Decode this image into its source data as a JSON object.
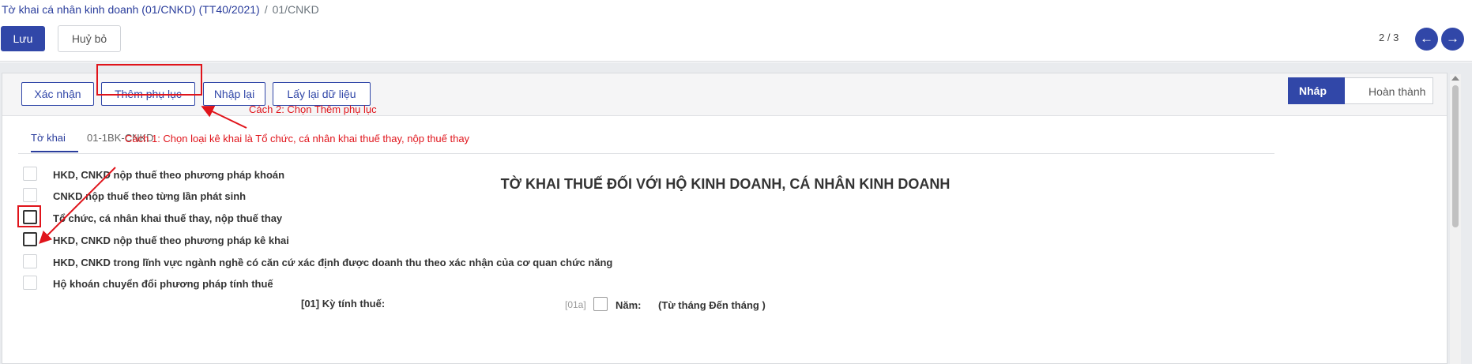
{
  "breadcrumb": {
    "parent": "Tờ khai cá nhân kinh doanh (01/CNKD) (TT40/2021)",
    "separator": "/",
    "current": "01/CNKD"
  },
  "toolbar": {
    "save_label": "Lưu",
    "discard_label": "Huỷ bỏ"
  },
  "pager": {
    "value": "2 / 3",
    "prev_icon": "arrow-left-icon",
    "next_icon": "arrow-right-icon"
  },
  "header_buttons": {
    "confirm": "Xác nhận",
    "add_appendix": "Thêm phụ lục",
    "re_enter": "Nhập lại",
    "reload_data": "Lấy lại dữ liệu"
  },
  "status_stages": {
    "active": "Nháp",
    "next": "Hoàn thành"
  },
  "annotations": {
    "method2": "Cách 2: Chọn Thêm phụ lục",
    "method1": "Cách 1: Chọn loại kê khai là Tổ chức, cá nhân khai thuế thay, nộp thuế thay",
    "color": "#e0141b"
  },
  "tabs": [
    {
      "label": "Tờ khai",
      "active": true
    },
    {
      "label": "01-1BK-CNKD",
      "active": false
    }
  ],
  "form_title": "TỜ KHAI THUẾ ĐỐI VỚI HỘ KINH DOANH, CÁ NHÂN KINH DOANH",
  "options": [
    {
      "label": "HKD, CNKD nộp thuế theo phương pháp khoán",
      "enabled": false
    },
    {
      "label": "CNKD nộp thuế theo từng lần phát sinh",
      "enabled": false
    },
    {
      "label": "Tổ chức, cá nhân khai thuế thay, nộp thuế thay",
      "enabled": true
    },
    {
      "label": "HKD, CNKD nộp thuế theo phương pháp kê khai",
      "enabled": true
    },
    {
      "label": "HKD, CNKD trong lĩnh vực ngành nghề có căn cứ xác định được doanh thu theo xác nhận của cơ quan chức năng",
      "enabled": false
    },
    {
      "label": "Hộ khoán chuyển đổi phương pháp tính thuế",
      "enabled": false
    }
  ],
  "tax_period": {
    "label": "[01] Kỳ tính thuế:",
    "code": "[01a]",
    "year_label": "Năm:",
    "range_label": "(Từ tháng      Đến tháng      )"
  },
  "colors": {
    "primary": "#3147a8",
    "background": "#e9ebee"
  }
}
